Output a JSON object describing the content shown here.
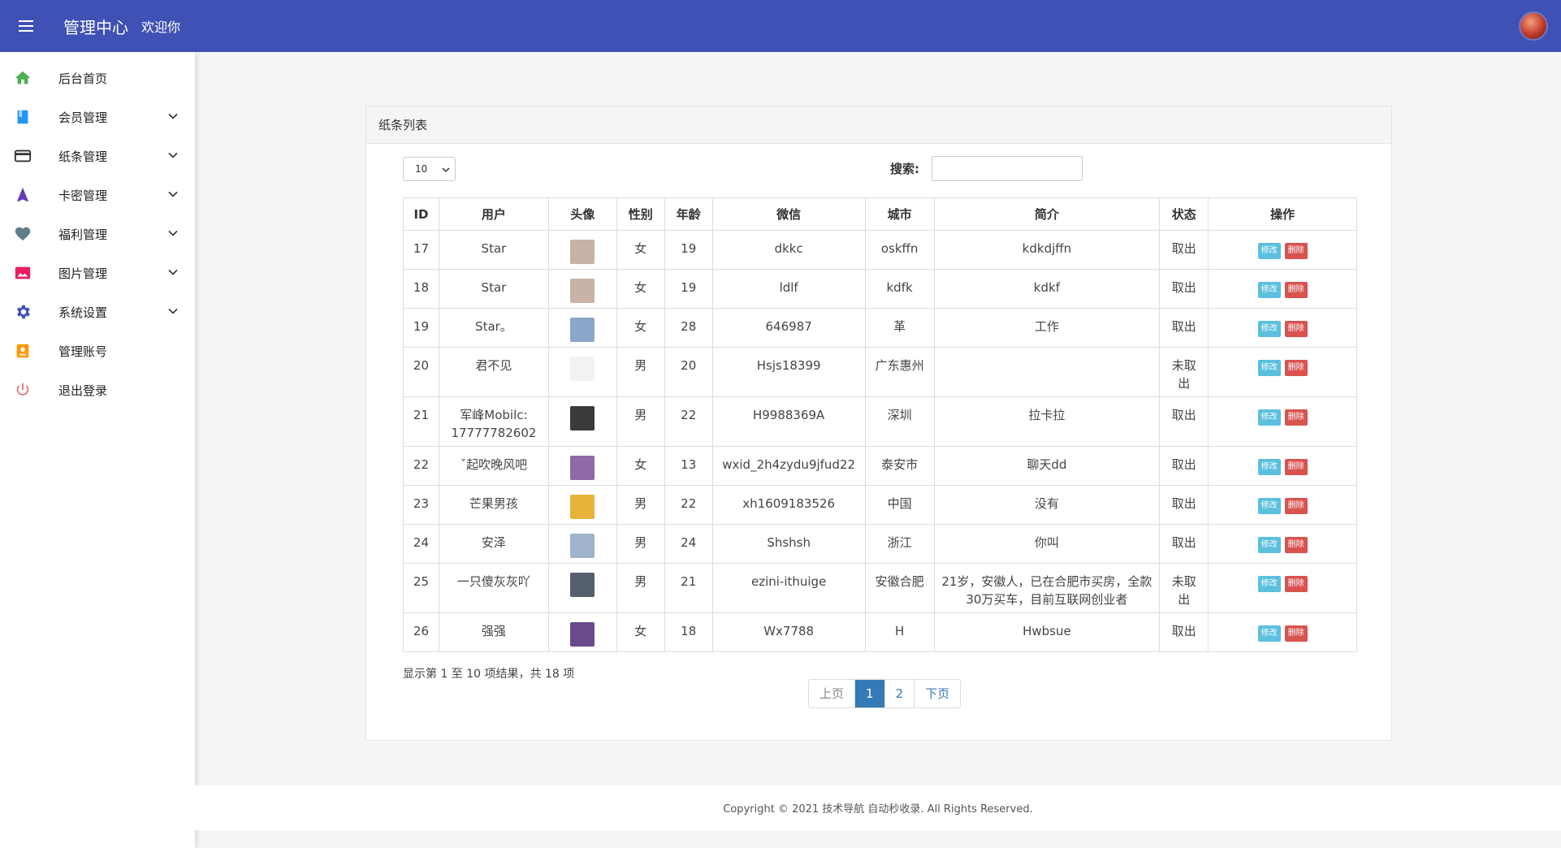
{
  "header": {
    "title": "管理中心",
    "welcome": "欢迎你"
  },
  "sidebar": {
    "items": [
      {
        "label": "后台首页",
        "icon": "home-icon",
        "color": "#4caf50",
        "expandable": false
      },
      {
        "label": "会员管理",
        "icon": "book-icon",
        "color": "#2196f3",
        "expandable": true
      },
      {
        "label": "纸条管理",
        "icon": "card-icon",
        "color": "#333333",
        "expandable": true
      },
      {
        "label": "卡密管理",
        "icon": "navigation-icon",
        "color": "#673ab7",
        "expandable": true
      },
      {
        "label": "福利管理",
        "icon": "heart-icon",
        "color": "#607d8b",
        "expandable": true
      },
      {
        "label": "图片管理",
        "icon": "image-icon",
        "color": "#e91e63",
        "expandable": true
      },
      {
        "label": "系统设置",
        "icon": "gear-icon",
        "color": "#3f51b5",
        "expandable": true
      },
      {
        "label": "管理账号",
        "icon": "badge-icon",
        "color": "#ff9800",
        "expandable": false
      },
      {
        "label": "退出登录",
        "icon": "power-icon",
        "color": "#e57373",
        "expandable": false
      }
    ]
  },
  "panel": {
    "title": "纸条列表",
    "page_length": "10",
    "search_label": "搜索:",
    "search_value": ""
  },
  "table": {
    "headers": [
      "ID",
      "用户",
      "头像",
      "性别",
      "年龄",
      "微信",
      "城市",
      "简介",
      "状态",
      "操作"
    ],
    "edit_label": "修改",
    "delete_label": "删除",
    "rows": [
      {
        "id": "17",
        "user": "Star",
        "gender": "女",
        "age": "19",
        "wechat": "dkkc",
        "city": "oskffn",
        "intro": "kdkdjffn",
        "status": "取出",
        "avatar": "#c9b2a6"
      },
      {
        "id": "18",
        "user": "Star",
        "gender": "女",
        "age": "19",
        "wechat": "ldlf",
        "city": "kdfk",
        "intro": "kdkf",
        "status": "取出",
        "avatar": "#c9b2a6"
      },
      {
        "id": "19",
        "user": "Star。",
        "gender": "女",
        "age": "28",
        "wechat": "646987",
        "city": "革",
        "intro": "工作",
        "status": "取出",
        "avatar": "#8aa6c8"
      },
      {
        "id": "20",
        "user": "君不见",
        "gender": "男",
        "age": "20",
        "wechat": "Hsjs18399",
        "city": "广东惠州",
        "intro": "",
        "status": "未取出",
        "avatar": "#f2f2f2"
      },
      {
        "id": "21",
        "user": "军峰Mobilc: 17777782602",
        "gender": "男",
        "age": "22",
        "wechat": "H9988369A",
        "city": "深圳",
        "intro": "拉卡拉",
        "status": "取出",
        "avatar": "#3a3a3a"
      },
      {
        "id": "22",
        "user": "ˇ起吹晚风吧",
        "gender": "女",
        "age": "13",
        "wechat": "wxid_2h4zydu9jfud22",
        "city": "泰安市",
        "intro": "聊天dd",
        "status": "取出",
        "avatar": "#8e6aa8"
      },
      {
        "id": "23",
        "user": "芒果男孩",
        "gender": "男",
        "age": "22",
        "wechat": "xh1609183526",
        "city": "中国",
        "intro": "没有",
        "status": "取出",
        "avatar": "#e7b33a"
      },
      {
        "id": "24",
        "user": "安泽",
        "gender": "男",
        "age": "24",
        "wechat": "Shshsh",
        "city": "浙江",
        "intro": "你叫",
        "status": "取出",
        "avatar": "#9fb4cc"
      },
      {
        "id": "25",
        "user": "一只傻灰灰吖",
        "gender": "男",
        "age": "21",
        "wechat": "ezini-ithuige",
        "city": "安徽合肥",
        "intro": "21岁，安徽人，已在合肥市买房，全款30万买车，目前互联网创业者",
        "status": "未取出",
        "avatar": "#55606e"
      },
      {
        "id": "26",
        "user": "强强",
        "gender": "女",
        "age": "18",
        "wechat": "Wx7788",
        "city": "H",
        "intro": "Hwbsue",
        "status": "取出",
        "avatar": "#6a4a8c"
      }
    ]
  },
  "pagination": {
    "info": "显示第 1 至 10 项结果，共 18 项",
    "prev": "上页",
    "pages": [
      "1",
      "2"
    ],
    "next": "下页",
    "current": "1"
  },
  "footer": {
    "text": "Copyright © 2021 技术导航 自动秒收录. All Rights Reserved."
  },
  "colors": {
    "topbar": "#3f51b5",
    "edit": "#5bc0de",
    "delete": "#d9534f",
    "page_active": "#337ab7"
  }
}
